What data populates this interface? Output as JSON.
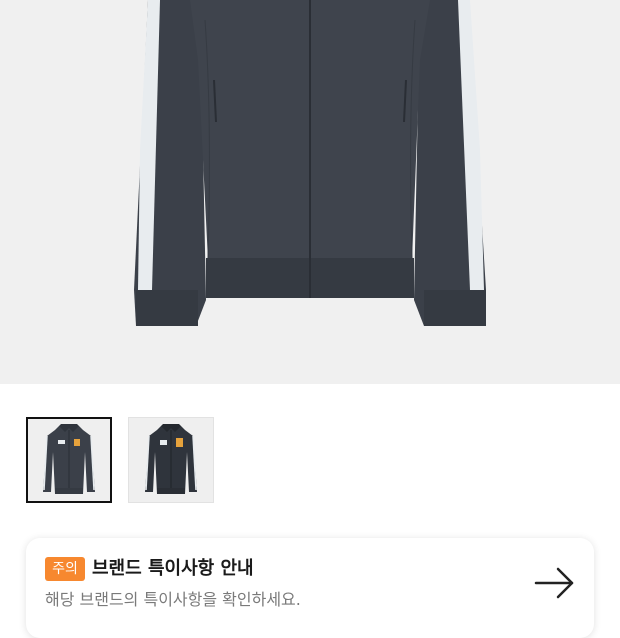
{
  "product": {
    "hero_image": "dark-gray-zip-track-jacket-with-white-sleeve-stripes",
    "colors": {
      "jacket": "#3b4049",
      "jacket_dark": "#2f343c",
      "stripe": "#e8ecef",
      "background": "#f0f0f0"
    }
  },
  "thumbnails": [
    {
      "name": "jacket-front-view",
      "selected": true
    },
    {
      "name": "jacket-front-view-alt",
      "selected": false
    }
  ],
  "notice": {
    "badge": "주의",
    "title": "브랜드 특이사항 안내",
    "description": "해당 브랜드의 특이사항을 확인하세요.",
    "arrow_icon": "arrow-right-icon",
    "badge_color": "#f7882f"
  }
}
